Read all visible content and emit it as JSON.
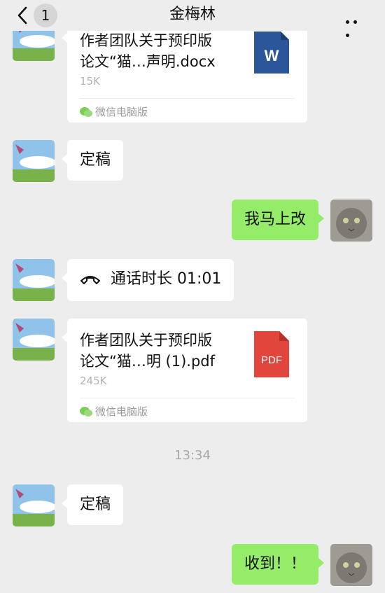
{
  "header": {
    "back_label": "<",
    "unread_count": "1",
    "title": "金梅林",
    "more_label": "…"
  },
  "messages": {
    "file1": {
      "name_line1": "作者团队关于预印版",
      "name_line2": "论文“猫…声明.docx",
      "size": "15K",
      "source": "微信电脑版",
      "file_type": "W",
      "icon_color": "#2b579a"
    },
    "msg_dinggao_1": "定稿",
    "msg_reply_1": "我马上改",
    "call": {
      "label": "通话时长 01:01"
    },
    "file2": {
      "name_line1": "作者团队关于预印版",
      "name_line2": "论文“猫…明 (1).pdf",
      "size": "245K",
      "source": "微信电脑版",
      "file_type": "PDF",
      "icon_color": "#e2453c"
    },
    "timestamp": "13:34",
    "msg_dinggao_2": "定稿",
    "msg_reply_2": "收到！！"
  },
  "colors": {
    "background": "#ededed",
    "my_bubble": "#95ec69",
    "their_bubble": "#ffffff"
  }
}
